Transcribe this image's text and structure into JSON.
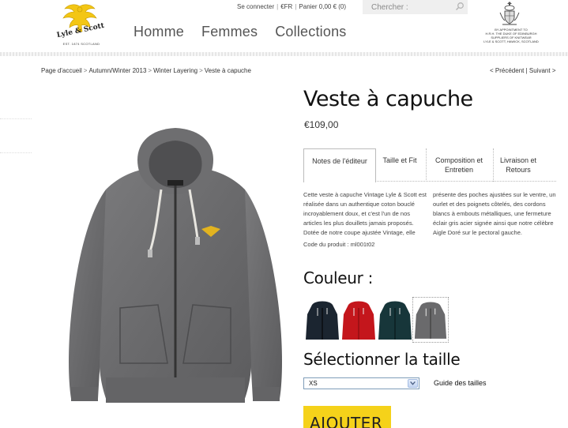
{
  "header": {
    "brand": "Lyle & Scott",
    "brand_sub": "EST. 1874 SCOTLAND",
    "topbar": {
      "login": "Se connecter",
      "currency": "€FR",
      "cart": "Panier 0,00 € (0)"
    },
    "search": {
      "placeholder": "Chercher :"
    },
    "nav": [
      "Homme",
      "Femmes",
      "Collections"
    ],
    "royal_warrant": [
      "BY APPOINTMENT TO",
      "H.R.H. THE DUKE OF EDINBURGH",
      "SUPPLIERS OF KNITWEAR",
      "LYLE & SCOTT, HAWICK, SCOTLAND"
    ]
  },
  "breadcrumb": [
    "Page d'accueil",
    "Autumn/Winter 2013",
    "Winter Layering",
    "Veste à capuche"
  ],
  "prevnext": {
    "prev": "< Précédent",
    "next": "Suivant >"
  },
  "product": {
    "title": "Veste à capuche",
    "price": "€109,00",
    "tabs": [
      {
        "label": "Notes de l'éditeur"
      },
      {
        "label": "Taille et Fit"
      },
      {
        "label": "Composition et Entretien"
      },
      {
        "label": "Livraison et Retours"
      }
    ],
    "description_left": "Cette veste à capuche Vintage Lyle & Scott est réalisée dans un authentique coton bouclé incroyablement doux, et c'est l'un de nos articles les plus douillets jamais proposés. Dotée de notre coupe ajustée Vintage, elle",
    "description_right": "présente des poches ajustées sur le ventre, un ourlet et des poignets côtelés, des cordons blancs à embouts métalliques, une fermeture éclair gris acier signée ainsi que notre célèbre Aigle Doré sur le pectoral gauche.",
    "code": "Code du produit : ml001t02",
    "color_label": "Couleur :",
    "colors": [
      {
        "name": "navy",
        "hex": "#1b2530"
      },
      {
        "name": "red",
        "hex": "#c4161c"
      },
      {
        "name": "dark-teal",
        "hex": "#17363a"
      },
      {
        "name": "grey-marl",
        "hex": "#6a6a6c"
      }
    ],
    "selected_color": 3,
    "size_label": "Sélectionner la taille",
    "size_selected": "XS",
    "size_guide": "Guide des tailles",
    "add_button": "AJOUTER"
  },
  "colors": {
    "accent": "#f5d21a",
    "logo_yellow": "#f3c614"
  }
}
